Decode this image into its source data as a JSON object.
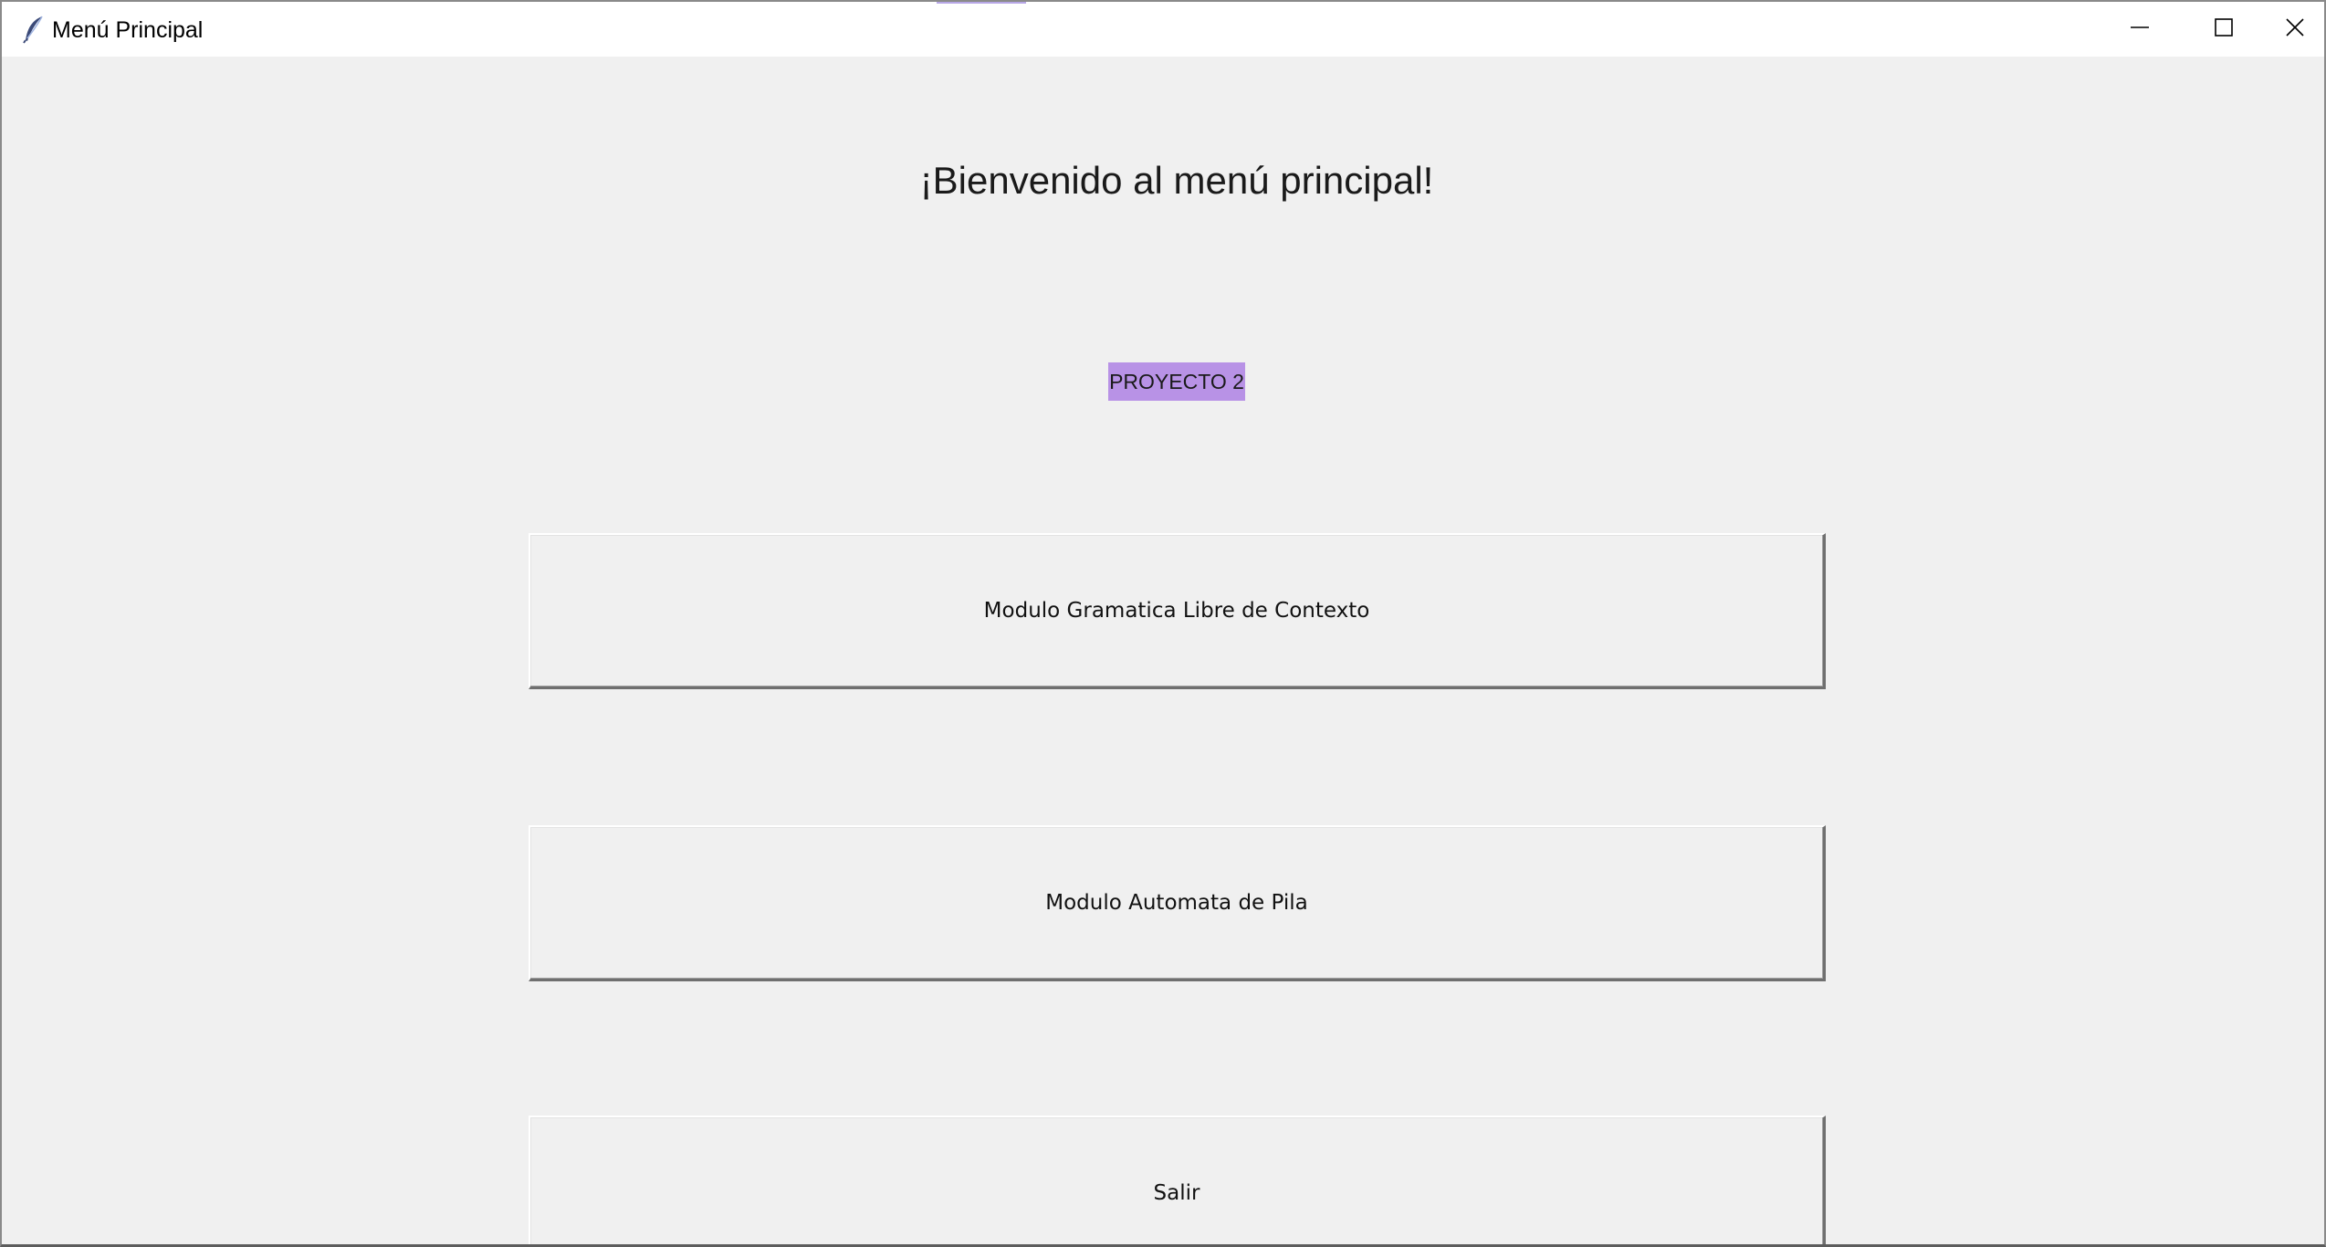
{
  "window": {
    "title": "Menú Principal",
    "app_icon": "feather-icon",
    "controls": {
      "minimize_icon": "minimize-icon",
      "maximize_icon": "maximize-icon",
      "close_icon": "close-icon"
    }
  },
  "main": {
    "heading": "¡Bienvenido al menú principal!",
    "badge": "PROYECTO 2",
    "buttons": [
      {
        "label": "Modulo Gramatica Libre de Contexto"
      },
      {
        "label": "Modulo Automata de Pila"
      },
      {
        "label": "Salir"
      }
    ]
  },
  "colors": {
    "background": "#f0f0f0",
    "badge": "#b892e6",
    "titlebar": "#ffffff"
  }
}
